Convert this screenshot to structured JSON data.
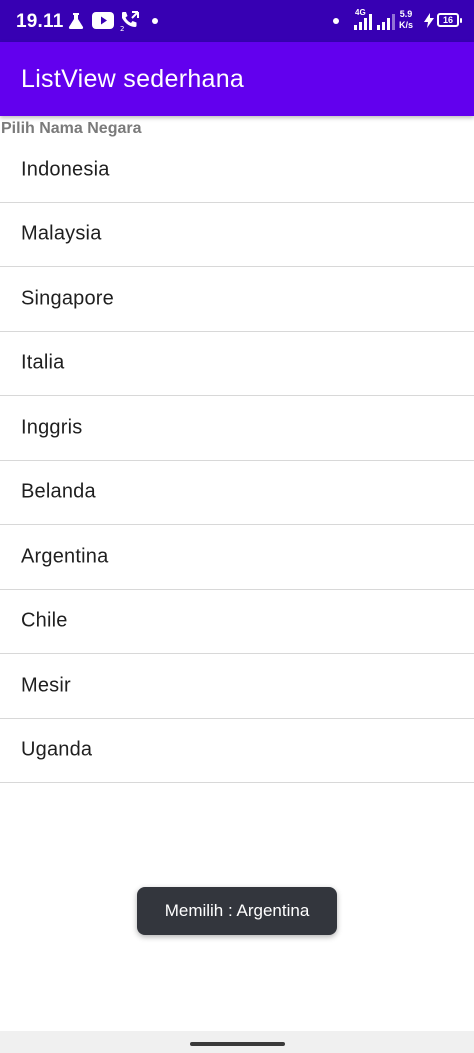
{
  "status_bar": {
    "time": "19.11",
    "network_label": "4G",
    "speed_value": "5.9",
    "speed_unit": "K/s",
    "battery_level": "16",
    "icons": [
      "flask-icon",
      "youtube-icon",
      "call-forward-icon",
      "signal-icon",
      "wifi-signal-icon",
      "charging-icon",
      "battery-icon"
    ]
  },
  "app_bar": {
    "title": "ListView sederhana"
  },
  "list": {
    "header": "Pilih Nama Negara",
    "items": [
      "Indonesia",
      "Malaysia",
      "Singapore",
      "Italia",
      "Inggris",
      "Belanda",
      "Argentina",
      "Chile",
      "Mesir",
      "Uganda"
    ]
  },
  "toast": {
    "message": "Memilih : Argentina"
  },
  "colors": {
    "status_bar": "#3700b3",
    "app_bar": "#6200ee",
    "toast_bg": "#33363d",
    "divider": "#d8d8d8"
  }
}
